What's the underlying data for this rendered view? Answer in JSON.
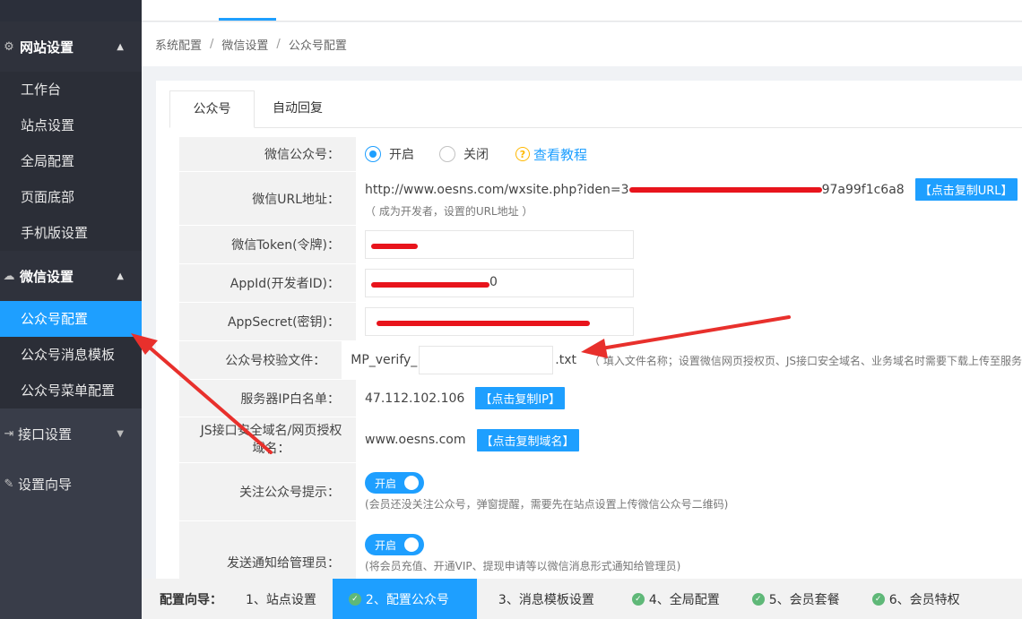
{
  "sidebar": {
    "groups": [
      {
        "label": "网站设置",
        "items": [
          "工作台",
          "站点设置",
          "全局配置",
          "页面底部",
          "手机版设置"
        ]
      },
      {
        "label": "微信设置",
        "items": [
          "公众号配置",
          "公众号消息模板",
          "公众号菜单配置"
        ]
      }
    ],
    "plain": [
      "接口设置",
      "设置向导"
    ]
  },
  "breadcrumb": [
    "系统配置",
    "微信设置",
    "公众号配置"
  ],
  "tabs": [
    "公众号",
    "自动回复"
  ],
  "form": {
    "wechat_label": "微信公众号：",
    "radio_on": "开启",
    "radio_off": "关闭",
    "tutorial": "查看教程",
    "url_label": "微信URL地址：",
    "url_value_a": "http://www.oesns.com/wxsite.php?iden=3",
    "url_value_b": "97a99f1c6a8",
    "copy_url": "【点击复制URL】",
    "url_hint": "（ 成为开发者，设置的URL地址 ）",
    "token_label": "微信Token(令牌)：",
    "appid_label": "AppId(开发者ID)：",
    "appid_tail": "0",
    "secret_label": "AppSecret(密钥)：",
    "verify_label": "公众号校验文件：",
    "verify_prefix": "MP_verify_",
    "verify_suffix": ".txt",
    "verify_hint": "（ 填入文件名称；设置微信网页授权页、JS接口安全域名、业务域名时需要下载上传至服务",
    "ip_label": "服务器IP白名单：",
    "ip_value": "47.112.102.106",
    "copy_ip": "【点击复制IP】",
    "js_label": "JS接口安全域名/网页授权域名：",
    "domain_value": "www.oesns.com",
    "copy_domain": "【点击复制域名】",
    "follow_label": "关注公众号提示：",
    "switch_on": "开启",
    "follow_hint": "(会员还没关注公众号，弹窗提醒，需要先在站点设置上传微信公众号二维码)",
    "notify_label": "发送通知给管理员：",
    "notify_hint": "(将会员充值、开通VIP、提现申请等以微信消息形式通知给管理员)"
  },
  "wizard": {
    "label": "配置向导：",
    "steps": [
      "1、站点设置",
      "2、配置公众号",
      "3、消息模板设置",
      "4、全局配置",
      "5、会员套餐",
      "6、会员特权"
    ]
  },
  "colors": {
    "accent": "#1e9fff",
    "sidebar": "#393d49",
    "check": "#5fb878",
    "redact": "#e8141c",
    "annotation": "#e8302c"
  }
}
